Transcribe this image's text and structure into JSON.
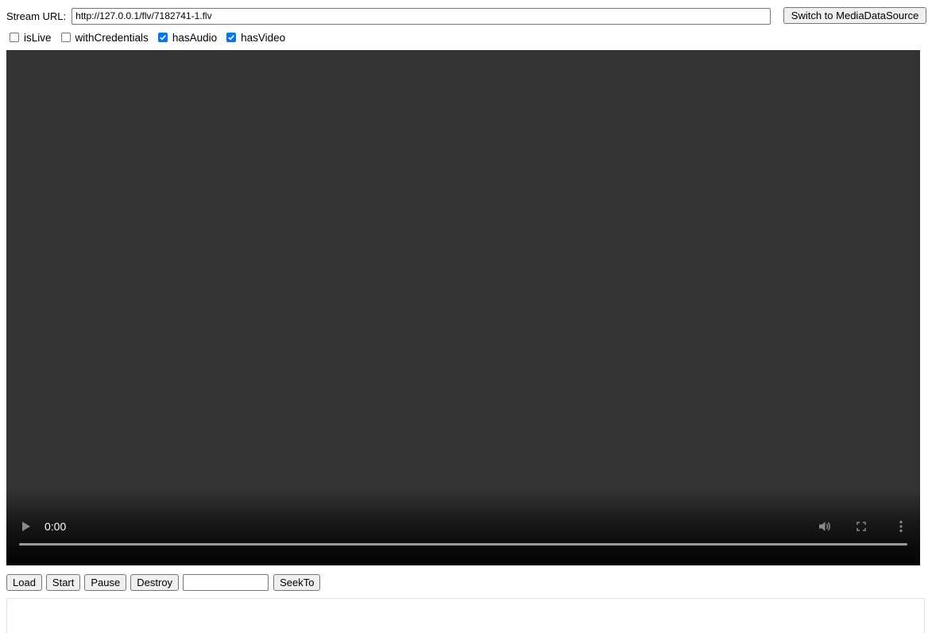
{
  "stream": {
    "label": "Stream URL:",
    "url_value": "http://127.0.0.1/flv/7182741-1.flv",
    "switch_label": "Switch to MediaDataSource"
  },
  "options": [
    {
      "label": "isLive",
      "checked": false
    },
    {
      "label": "withCredentials",
      "checked": false
    },
    {
      "label": "hasAudio",
      "checked": true
    },
    {
      "label": "hasVideo",
      "checked": true
    }
  ],
  "player": {
    "time": "0:00",
    "progress": 0,
    "icons": {
      "play": "play-icon",
      "volume": "volume-icon",
      "fullscreen": "fullscreen-icon",
      "menu": "more-vert-icon"
    }
  },
  "actions": {
    "load": "Load",
    "start": "Start",
    "pause": "Pause",
    "destroy": "Destroy",
    "seek_value": "",
    "seekto": "SeekTo"
  },
  "log": {
    "value": ""
  },
  "colors": {
    "video_bg": "#333333",
    "checkbox_checked": "#0075ff",
    "button_bg": "#efefef"
  }
}
